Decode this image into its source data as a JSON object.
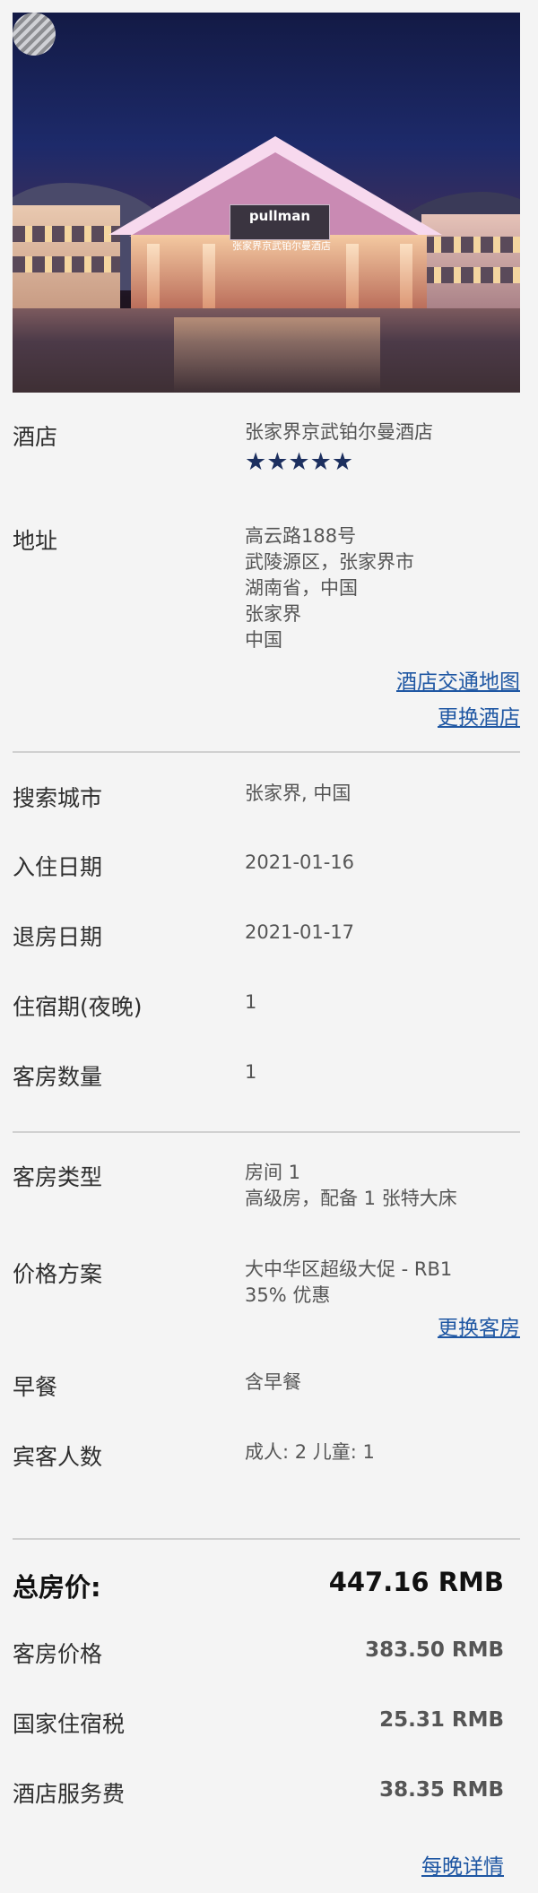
{
  "hotel": {
    "label": "酒店",
    "name": "张家界京武铂尔曼酒店",
    "stars": "★★★★★",
    "sign_brand": "pullman",
    "sign_name": "张家界京武铂尔曼酒店"
  },
  "address": {
    "label": "地址",
    "lines": [
      "高云路188号",
      "武陵源区，张家界市",
      "湖南省，中国",
      "张家界",
      "中国"
    ],
    "map_link": "酒店交通地图",
    "change_hotel_link": "更换酒店"
  },
  "search_city": {
    "label": "搜索城市",
    "value": "张家界, 中国"
  },
  "check_in": {
    "label": "入住日期",
    "value": "2021-01-16"
  },
  "check_out": {
    "label": "退房日期",
    "value": "2021-01-17"
  },
  "nights": {
    "label": "住宿期(夜晚)",
    "value": "1"
  },
  "rooms": {
    "label": "客房数量",
    "value": "1"
  },
  "room_type": {
    "label": "客房类型",
    "line1": "房间 1",
    "line2": "高级房，配备 1 张特大床"
  },
  "rate_plan": {
    "label": "价格方案",
    "line1": "大中华区超级大促 - RB1",
    "line2": "35% 优惠",
    "change_room_link": "更换客房"
  },
  "breakfast": {
    "label": "早餐",
    "value": "含早餐"
  },
  "guests": {
    "label": "宾客人数",
    "value": "成人: 2 儿童: 1"
  },
  "totals": {
    "total_label": "总房价:",
    "total_value": "447.16 RMB",
    "room_price_label": "客房价格",
    "room_price_value": "383.50 RMB",
    "tax_label": "国家住宿税",
    "tax_value": "25.31 RMB",
    "service_label": "酒店服务费",
    "service_value": "38.35 RMB",
    "nightly_link": "每晚详情"
  },
  "colors": {
    "link": "#1f57a3",
    "stars": "#1c2f5f",
    "divider": "#d0d0d0",
    "background": "#f4f4f4"
  }
}
